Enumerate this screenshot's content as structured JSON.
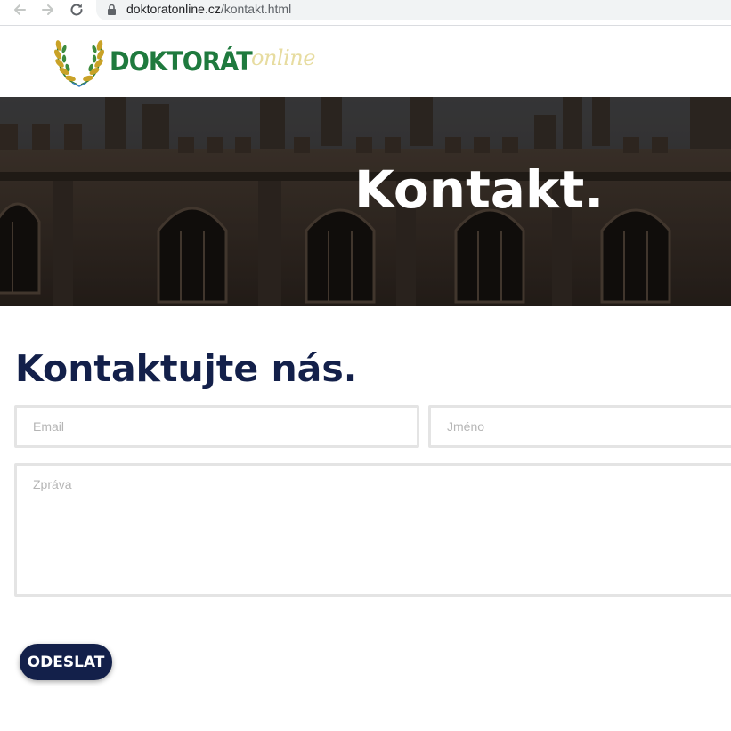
{
  "browser": {
    "url_host": "doktoratonline.cz",
    "url_path": "/kontakt.html"
  },
  "header": {
    "logo_word": "DOKTORÁT",
    "logo_suffix": "online"
  },
  "hero": {
    "title": "Kontakt."
  },
  "contact": {
    "heading": "Kontaktujte nás.",
    "email_placeholder": "Email",
    "name_placeholder": "Jméno",
    "message_placeholder": "Zpráva",
    "submit_label": "ODESLAT"
  },
  "colors": {
    "navy": "#13204a",
    "logo_green": "#1f7a3e",
    "logo_gold": "#e7dca0"
  }
}
